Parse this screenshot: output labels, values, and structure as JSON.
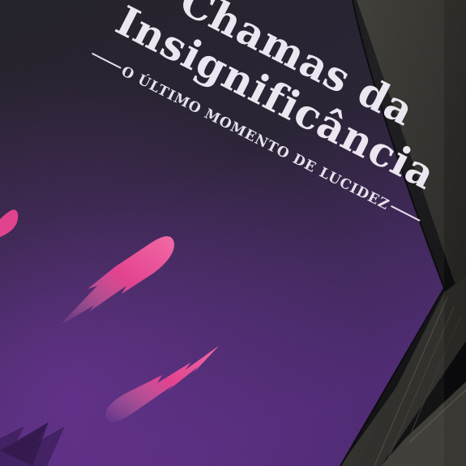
{
  "book": {
    "title_line1": "Chamas da",
    "title_line2": "Insignificância",
    "subtitle": "O último momento de lucidez"
  },
  "colors": {
    "background": "#070708",
    "cover_top": "#1c1a22",
    "cover_bottom": "#4a2370",
    "flame_pink": "#e2438f",
    "title_text": "#ece6f0"
  },
  "icons": {
    "flame_streaks": "falling-flame-meteor-shapes"
  }
}
